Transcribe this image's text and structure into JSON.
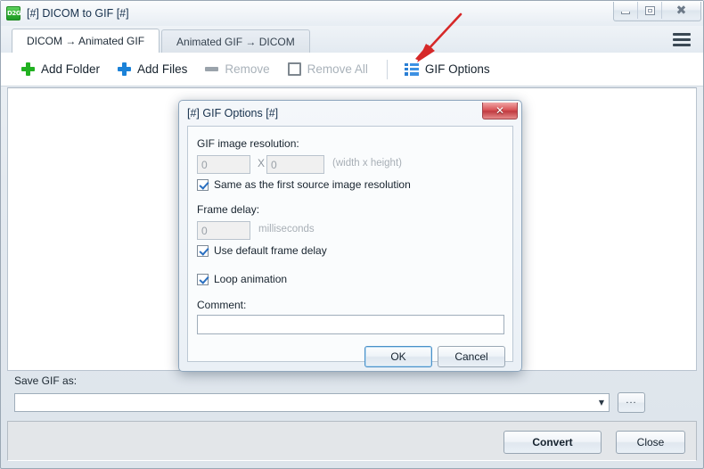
{
  "window": {
    "title": "[#] DICOM to GIF [#]",
    "app_icon": "d2g-app-icon",
    "icon_text": "D2G",
    "minimize_label": "Minimize",
    "maximize_label": "Maximize",
    "close_label": "Close"
  },
  "tabs": [
    {
      "label": "DICOM  →  Animated GIF",
      "active": true
    },
    {
      "label": "Animated GIF  →  DICOM",
      "active": false
    }
  ],
  "menu": {
    "hamburger_label": "Menu"
  },
  "toolbar": {
    "items": [
      {
        "label": "Add Folder",
        "icon": "plus-green-icon",
        "disabled": false
      },
      {
        "label": "Add Files",
        "icon": "plus-blue-icon",
        "disabled": false
      },
      {
        "label": "Remove",
        "icon": "minus-icon",
        "disabled": true
      },
      {
        "label": "Remove All",
        "icon": "empty-square-icon",
        "disabled": true
      },
      {
        "label": "GIF Options",
        "icon": "list-icon",
        "disabled": false
      }
    ]
  },
  "save_section": {
    "label": "Save GIF as:",
    "value": "",
    "placeholder": "",
    "dropdown_arrow": "▼",
    "browse_label": "..."
  },
  "footer": {
    "convert_label": "Convert",
    "close_label": "Close"
  },
  "dialog": {
    "title": "[#] GIF Options [#]",
    "close_glyph": "✕",
    "resolution": {
      "label": "GIF image resolution:",
      "width_value": "0",
      "height_value": "0",
      "separator": "X",
      "hint": "(width x height)",
      "checkbox_label": "Same as the first source image resolution",
      "checkbox_checked": true
    },
    "frame_delay": {
      "label": "Frame delay:",
      "value": "0",
      "unit": "milliseconds",
      "checkbox_label": "Use default frame delay",
      "checkbox_checked": true
    },
    "loop": {
      "checkbox_label": "Loop animation",
      "checkbox_checked": true
    },
    "comment": {
      "label": "Comment:",
      "value": "",
      "placeholder": ""
    },
    "buttons": {
      "ok_label": "OK",
      "cancel_label": "Cancel"
    }
  },
  "annotation": {
    "arrow_color": "#d62828",
    "arrow_name": "red-pointer-arrow"
  },
  "colors": {
    "accent_blue": "#2a7fd4",
    "add_folder_green": "#21b121",
    "add_files_blue": "#1b82d8",
    "dialog_close_red": "#c03b40",
    "annotation_red": "#d62828"
  }
}
